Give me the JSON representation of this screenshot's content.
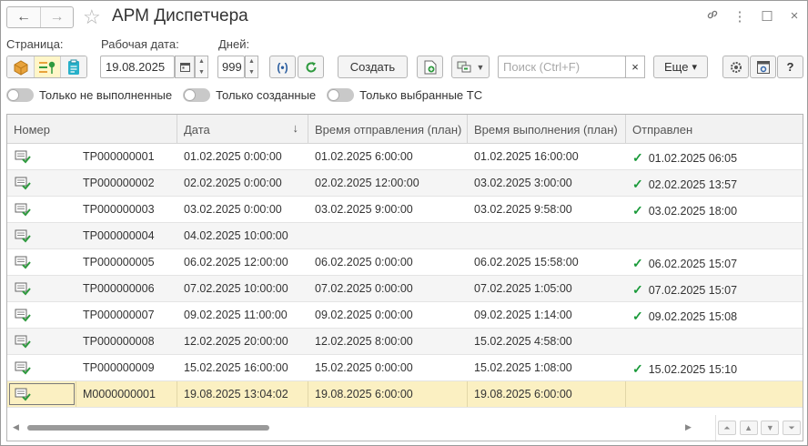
{
  "window": {
    "title": "АРМ Диспетчера",
    "back_icon": "←",
    "forward_icon": "→",
    "star_icon": "☆",
    "link_icon": "🔗",
    "menu_icon": "⋮",
    "maximize_icon": "☐",
    "close_icon": "×"
  },
  "toolbar": {
    "page_label": "Страница:",
    "work_date_label": "Рабочая дата:",
    "work_date_value": "19.08.2025",
    "days_label": "Дней:",
    "days_value": "999",
    "create_label": "Создать",
    "search_placeholder": "Поиск (Ctrl+F)",
    "clear_icon": "×",
    "more_label": "Еще",
    "more_chevron": "▾",
    "help_label": "?"
  },
  "toggles": [
    {
      "label": "Только не выполненные"
    },
    {
      "label": "Только созданные"
    },
    {
      "label": "Только выбранные ТС"
    }
  ],
  "table": {
    "columns": [
      "Номер",
      "Дата",
      "Время отправления (план)",
      "Время выполнения (план)",
      "Отправлен"
    ],
    "sort_icon": "↓",
    "check_mark": "✓",
    "rows": [
      {
        "number": "TP000000001",
        "date": "01.02.2025 0:00:00",
        "depart": "01.02.2025 6:00:00",
        "done": "01.02.2025 16:00:00",
        "sent": "01.02.2025 06:05",
        "sent_check": true
      },
      {
        "number": "TP000000002",
        "date": "02.02.2025 0:00:00",
        "depart": "02.02.2025 12:00:00",
        "done": "03.02.2025 3:00:00",
        "sent": "02.02.2025 13:57",
        "sent_check": true
      },
      {
        "number": "TP000000003",
        "date": "03.02.2025 0:00:00",
        "depart": "03.02.2025 9:00:00",
        "done": "03.02.2025 9:58:00",
        "sent": "03.02.2025 18:00",
        "sent_check": true
      },
      {
        "number": "TP000000004",
        "date": "04.02.2025 10:00:00",
        "depart": "",
        "done": "",
        "sent": "",
        "sent_check": false
      },
      {
        "number": "TP000000005",
        "date": "06.02.2025 12:00:00",
        "depart": "06.02.2025 0:00:00",
        "done": "06.02.2025 15:58:00",
        "sent": "06.02.2025 15:07",
        "sent_check": true
      },
      {
        "number": "TP000000006",
        "date": "07.02.2025 10:00:00",
        "depart": "07.02.2025 0:00:00",
        "done": "07.02.2025 1:05:00",
        "sent": "07.02.2025 15:07",
        "sent_check": true
      },
      {
        "number": "TP000000007",
        "date": "09.02.2025 11:00:00",
        "depart": "09.02.2025 0:00:00",
        "done": "09.02.2025 1:14:00",
        "sent": "09.02.2025 15:08",
        "sent_check": true
      },
      {
        "number": "TP000000008",
        "date": "12.02.2025 20:00:00",
        "depart": "12.02.2025 8:00:00",
        "done": "15.02.2025 4:58:00",
        "sent": "",
        "sent_check": false
      },
      {
        "number": "TP000000009",
        "date": "15.02.2025 16:00:00",
        "depart": "15.02.2025 0:00:00",
        "done": "15.02.2025 1:08:00",
        "sent": "15.02.2025 15:10",
        "sent_check": true
      },
      {
        "number": "M0000000001",
        "date": "19.08.2025 13:04:02",
        "depart": "19.08.2025 6:00:00",
        "done": "19.08.2025 6:00:00",
        "sent": "",
        "sent_check": false
      }
    ]
  },
  "colors": {
    "selected_row": "#fbf0c2",
    "check": "#1a9a3a",
    "accent_green": "#2e9a3e"
  }
}
